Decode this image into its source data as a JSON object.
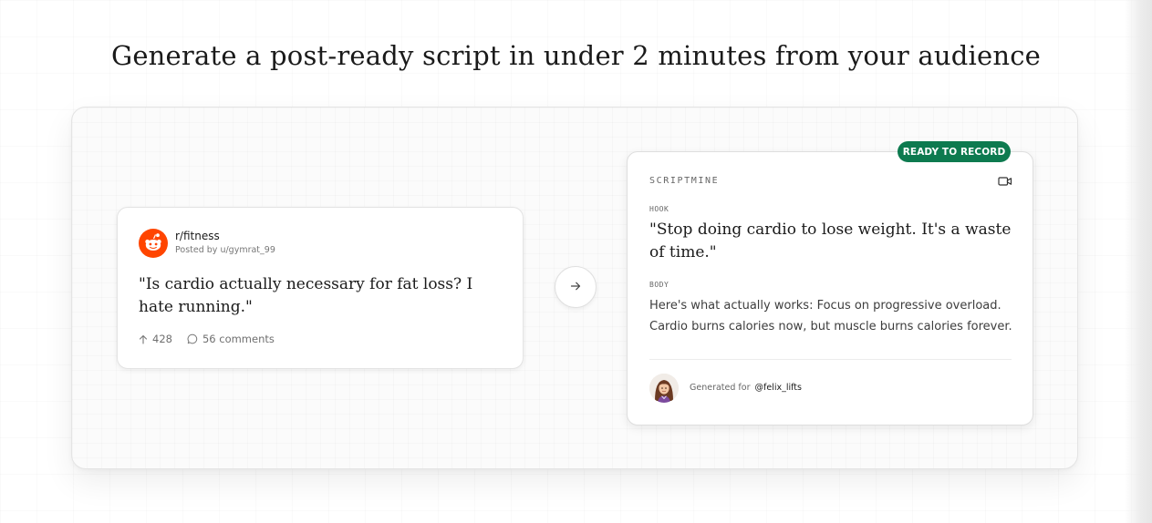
{
  "headline": "Generate a post-ready script in under 2 minutes from your audience",
  "reddit_post": {
    "icon": "reddit-logo-icon",
    "subreddit": "r/fitness",
    "posted_by": "Posted by u/gymrat_99",
    "title": "\"Is cardio actually necessary for fat loss? I hate running.\"",
    "upvotes": "428",
    "comments": "56 comments"
  },
  "arrow": {
    "icon": "arrow-right-icon"
  },
  "script": {
    "badge": "READY TO RECORD",
    "brand": "SCRIPTMINE",
    "video_icon": "video-camera-icon",
    "hook_label": "HOOK",
    "hook_text": "\"Stop doing cardio to lose weight. It's a waste of time.\"",
    "body_label": "BODY",
    "body_text": "Here's what actually works: Focus on progressive overload. Cardio burns calories now, but muscle burns calories forever.",
    "generated_for_label": "Generated for",
    "handle": "@felix_lifts"
  },
  "colors": {
    "reddit_orange": "#ff4500",
    "badge_green": "#0d7a4f"
  }
}
